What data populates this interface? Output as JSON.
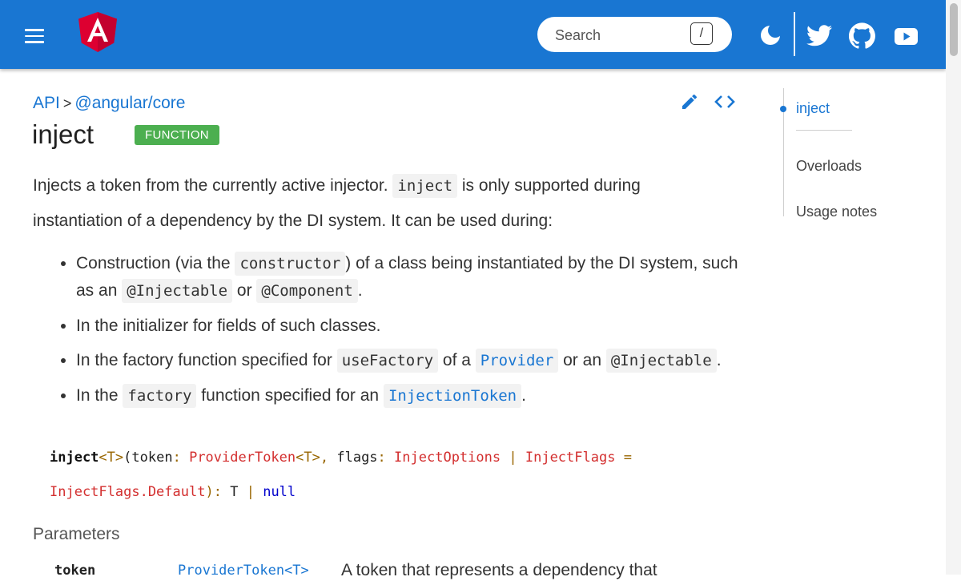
{
  "topbar": {
    "search_placeholder": "Search",
    "search_shortcut": "/",
    "icons": [
      "menu-icon",
      "angular-logo",
      "theme-toggle-icon",
      "twitter-icon",
      "github-icon",
      "youtube-icon"
    ],
    "colors": {
      "bar": "#1976d2",
      "text": "#ffffff",
      "logo": "#dd0031"
    }
  },
  "breadcrumb": {
    "items": [
      "API",
      "@angular/core"
    ],
    "separator": ">"
  },
  "page": {
    "title": "inject",
    "badge": "FUNCTION",
    "badge_color": "#4caf50"
  },
  "intro": {
    "t1": "Injects a token from the currently active injector. ",
    "code1": "inject",
    "t2": " is only supported during instantiation of a dependency by the DI system. It can be used during:"
  },
  "bullets": {
    "b1": {
      "t1": "Construction (via the ",
      "code1": "constructor",
      "t2": ") of a class being instantiated by the DI system, such as an ",
      "code2": "@Injectable",
      "t3": " or ",
      "code3": "@Component",
      "t4": "."
    },
    "b2": {
      "t1": "In the initializer for fields of such classes."
    },
    "b3": {
      "t1": "In the factory function specified for ",
      "code1": "useFactory",
      "t2": " of a ",
      "code2": "Provider",
      "t3": " or an ",
      "code3": "@Injectable",
      "t4": "."
    },
    "b4": {
      "t1": "In the ",
      "code1": "factory",
      "t2": " function specified for an ",
      "code2": "InjectionToken",
      "t3": "."
    }
  },
  "signature": {
    "name": "inject",
    "generic": "<T>",
    "open": "(",
    "param1": "token",
    "colon": ":",
    "type1": "ProviderToken",
    "type1_generic": "<T>",
    "comma": ",",
    "param2": "flags",
    "type2": "InjectOptions",
    "pipe": "|",
    "type3": "InjectFlags",
    "eq": "=",
    "default": "InjectFlags.Default",
    "close": "):",
    "ret1": "T",
    "ret2": "null"
  },
  "parameters": {
    "heading": "Parameters",
    "rows": [
      {
        "name": "token",
        "type": "ProviderToken<T>",
        "description": "A token that represents a dependency that"
      }
    ]
  },
  "toc": {
    "items": [
      "inject",
      "Overloads",
      "Usage notes"
    ],
    "active": "inject"
  }
}
